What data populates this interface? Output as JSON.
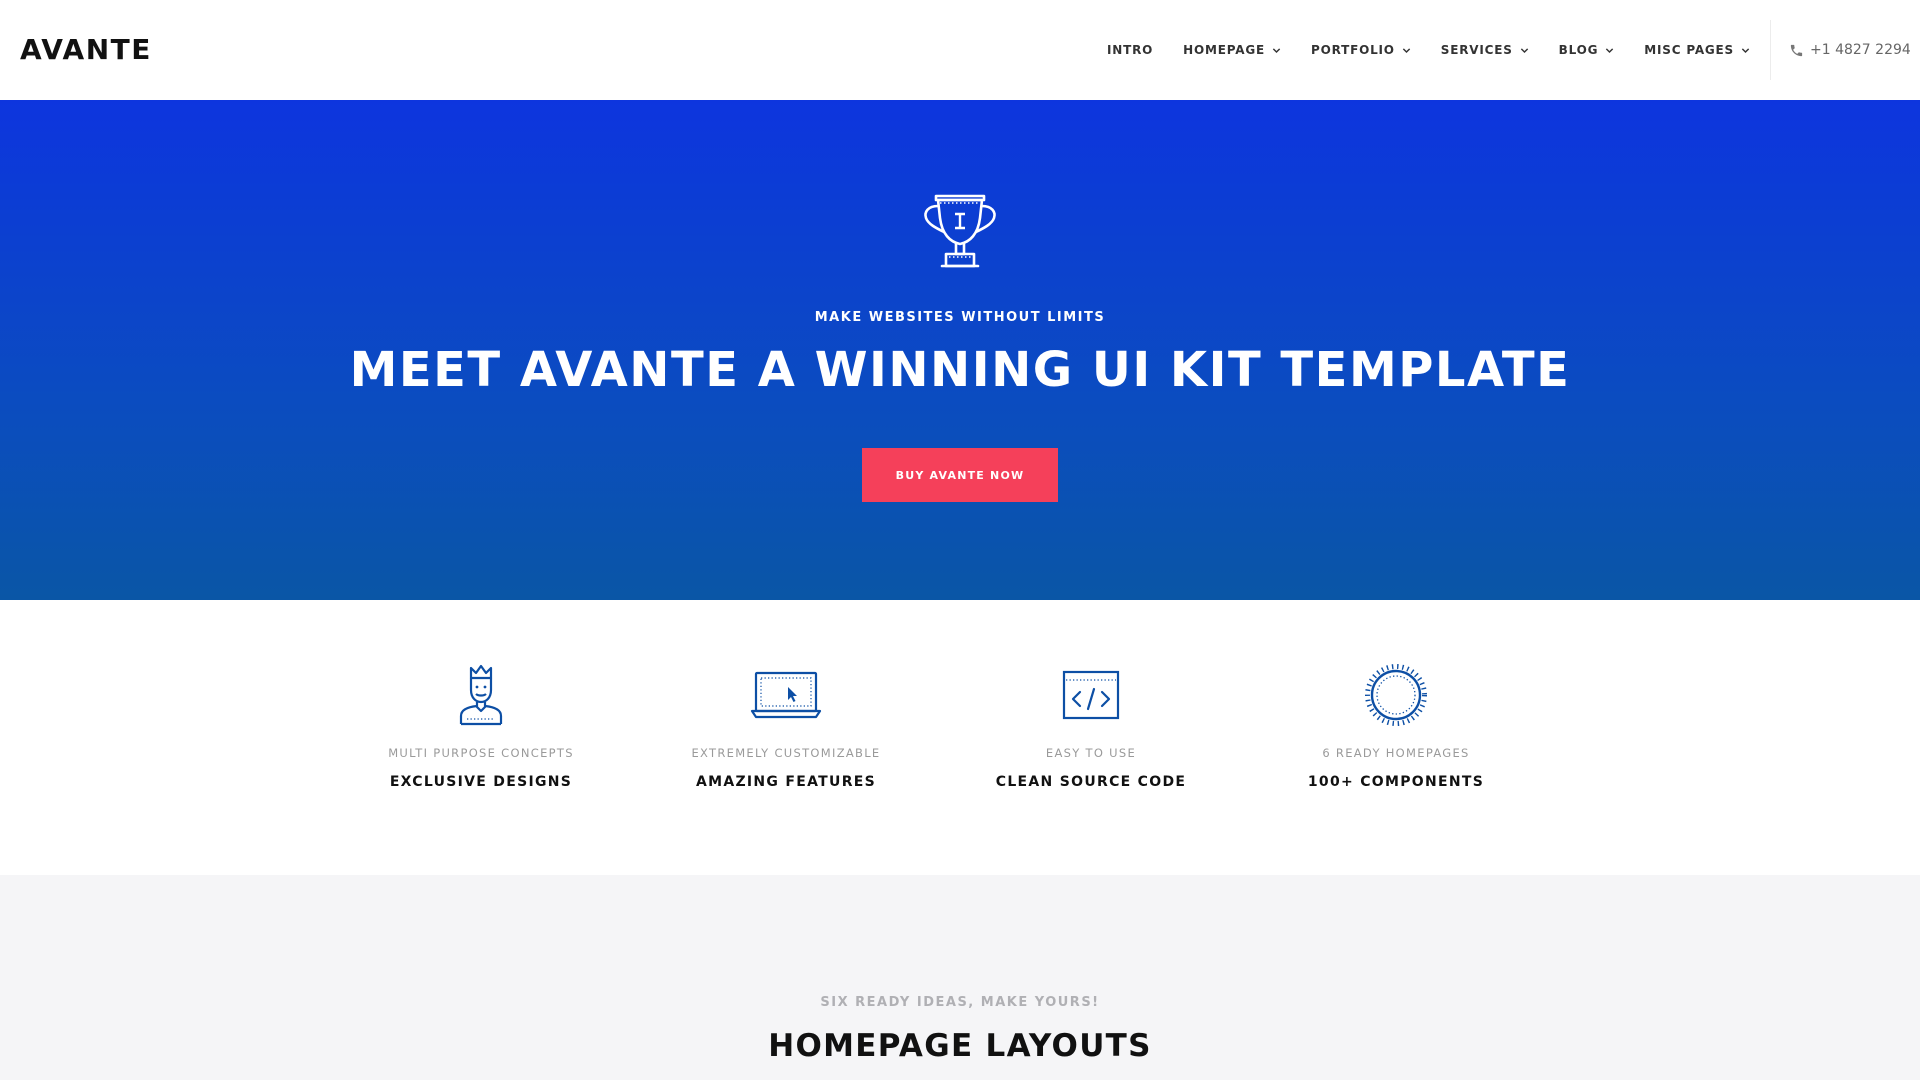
{
  "header": {
    "logo": "AVANTE",
    "nav": [
      {
        "label": "INTRO",
        "has_dropdown": false
      },
      {
        "label": "HOMEPAGE",
        "has_dropdown": true
      },
      {
        "label": "PORTFOLIO",
        "has_dropdown": true
      },
      {
        "label": "SERVICES",
        "has_dropdown": true
      },
      {
        "label": "BLOG",
        "has_dropdown": true
      },
      {
        "label": "MISC PAGES",
        "has_dropdown": true
      }
    ],
    "phone": "+1 4827 2294",
    "phone_icon": "phone-icon"
  },
  "hero": {
    "icon": "trophy-icon",
    "eyebrow": "MAKE WEBSITES WITHOUT LIMITS",
    "title": "MEET AVANTE A WINNING UI KIT TEMPLATE",
    "button_label": "BUY AVANTE NOW"
  },
  "features": [
    {
      "icon": "king-icon",
      "subtitle": "MULTI PURPOSE CONCEPTS",
      "title": "EXCLUSIVE DESIGNS"
    },
    {
      "icon": "laptop-cursor-icon",
      "subtitle": "EXTREMELY CUSTOMIZABLE",
      "title": "AMAZING FEATURES"
    },
    {
      "icon": "code-window-icon",
      "subtitle": "EASY TO USE",
      "title": "CLEAN SOURCE CODE"
    },
    {
      "icon": "badge-circle-icon",
      "subtitle": "6 READY HOMEPAGES",
      "title": "100+ COMPONENTS"
    }
  ],
  "layouts": {
    "eyebrow": "SIX READY IDEAS, MAKE YOURS!",
    "title": "HOMEPAGE LAYOUTS"
  },
  "colors": {
    "hero_gradient_top": "#0d35de",
    "hero_gradient_bottom": "#0a56a6",
    "button": "#f5405a",
    "icon_blue": "#0d4fa5",
    "section_gray": "#f5f5f7"
  }
}
